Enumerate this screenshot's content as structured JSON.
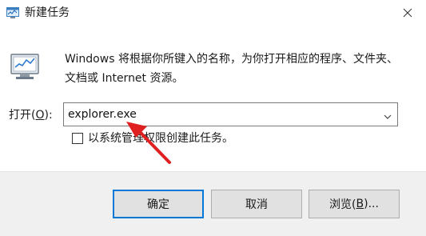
{
  "window": {
    "title": "新建任务"
  },
  "description": "Windows 将根据你所键入的名称，为你打开相应的程序、文件夹、文档或 Internet 资源。",
  "open": {
    "label_prefix": "打开(",
    "label_access_key": "O",
    "label_suffix": "):",
    "value": "explorer.exe"
  },
  "admin_checkbox": {
    "label": "以系统管理权限创建此任务。",
    "checked": false
  },
  "buttons": {
    "ok": "确定",
    "cancel": "取消",
    "browse_prefix": "浏览(",
    "browse_access_key": "B",
    "browse_suffix": ")..."
  },
  "colors": {
    "annotation_arrow": "#e02020",
    "focus_border": "#0078d7"
  },
  "icons": [
    "task-manager-icon",
    "close-icon",
    "run-program-icon",
    "chevron-down-icon"
  ]
}
